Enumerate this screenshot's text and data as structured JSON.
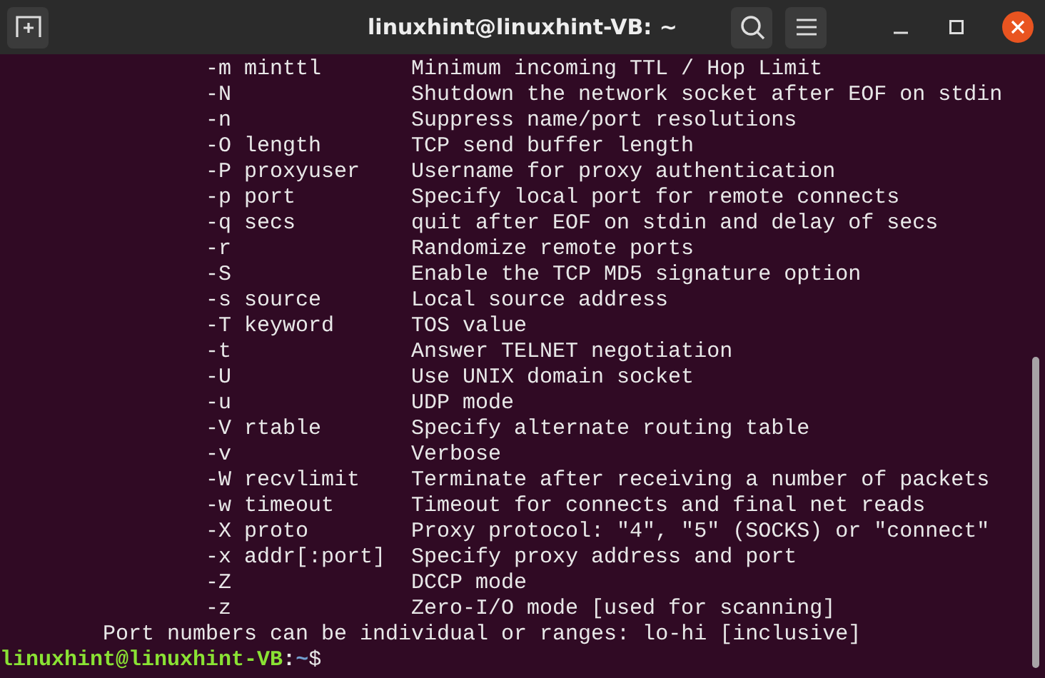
{
  "window": {
    "title": "linuxhint@linuxhint-VB: ~"
  },
  "options": [
    {
      "option": "-m minttl",
      "description": "Minimum incoming TTL / Hop Limit"
    },
    {
      "option": "-N",
      "description": "Shutdown the network socket after EOF on stdin"
    },
    {
      "option": "-n",
      "description": "Suppress name/port resolutions"
    },
    {
      "option": "-O length",
      "description": "TCP send buffer length"
    },
    {
      "option": "-P proxyuser",
      "description": "Username for proxy authentication"
    },
    {
      "option": "-p port",
      "description": "Specify local port for remote connects"
    },
    {
      "option": "-q secs",
      "description": "quit after EOF on stdin and delay of secs"
    },
    {
      "option": "-r",
      "description": "Randomize remote ports"
    },
    {
      "option": "-S",
      "description": "Enable the TCP MD5 signature option"
    },
    {
      "option": "-s source",
      "description": "Local source address"
    },
    {
      "option": "-T keyword",
      "description": "TOS value"
    },
    {
      "option": "-t",
      "description": "Answer TELNET negotiation"
    },
    {
      "option": "-U",
      "description": "Use UNIX domain socket"
    },
    {
      "option": "-u",
      "description": "UDP mode"
    },
    {
      "option": "-V rtable",
      "description": "Specify alternate routing table"
    },
    {
      "option": "-v",
      "description": "Verbose"
    },
    {
      "option": "-W recvlimit",
      "description": "Terminate after receiving a number of packets"
    },
    {
      "option": "-w timeout",
      "description": "Timeout for connects and final net reads"
    },
    {
      "option": "-X proto",
      "description": "Proxy protocol: \"4\", \"5\" (SOCKS) or \"connect\""
    },
    {
      "option": "-x addr[:port]",
      "description": "Specify proxy address and port"
    },
    {
      "option": "-Z",
      "description": "DCCP mode"
    },
    {
      "option": "-z",
      "description": "Zero-I/O mode [used for scanning]"
    }
  ],
  "note": "Port numbers can be individual or ranges: lo-hi [inclusive]",
  "prompt": {
    "user_host": "linuxhint@linuxhint-VB",
    "separator": ":",
    "path": "~",
    "symbol": "$"
  }
}
